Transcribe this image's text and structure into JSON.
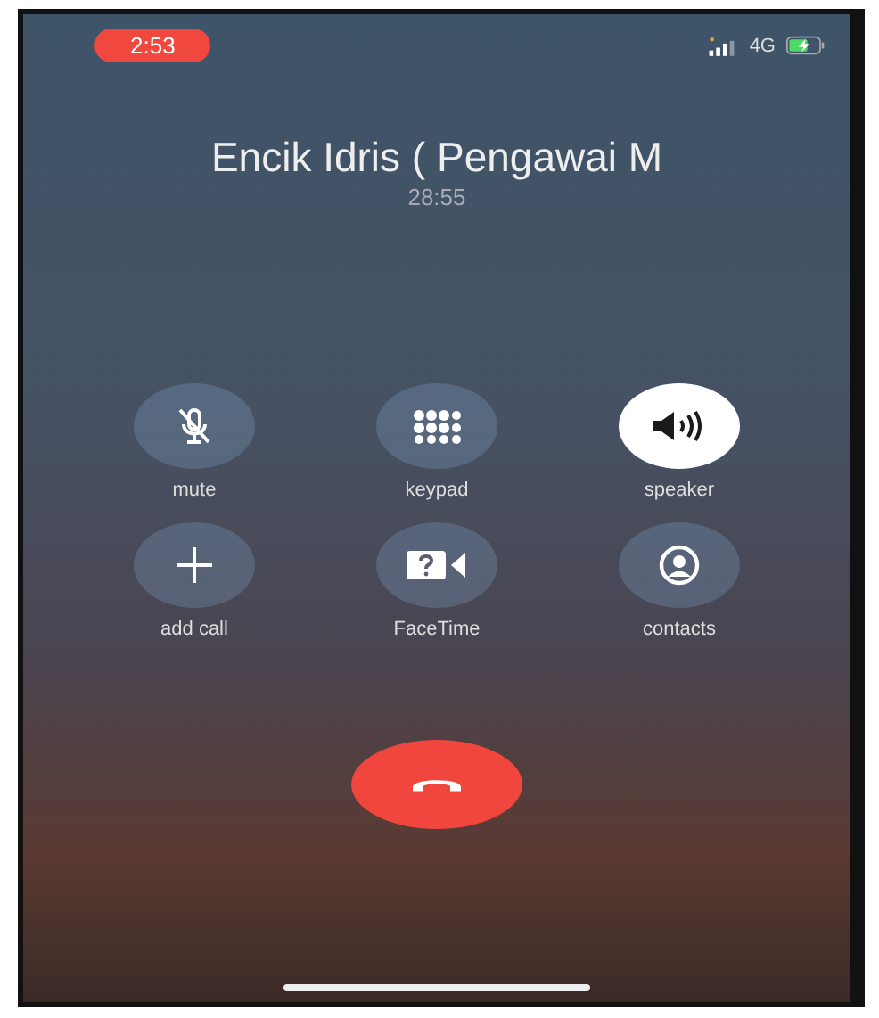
{
  "status_bar": {
    "call_time": "2:53",
    "network": "4G"
  },
  "caller": {
    "name": "Encik Idris ( Pengawai M",
    "duration": "28:55"
  },
  "controls": [
    {
      "kind": "mute",
      "label": "mute",
      "selected": false
    },
    {
      "kind": "keypad",
      "label": "keypad",
      "selected": false
    },
    {
      "kind": "speaker",
      "label": "speaker",
      "selected": true
    },
    {
      "kind": "add",
      "label": "add call",
      "selected": false
    },
    {
      "kind": "facetime",
      "label": "FaceTime",
      "selected": false
    },
    {
      "kind": "contacts",
      "label": "contacts",
      "selected": false
    }
  ]
}
